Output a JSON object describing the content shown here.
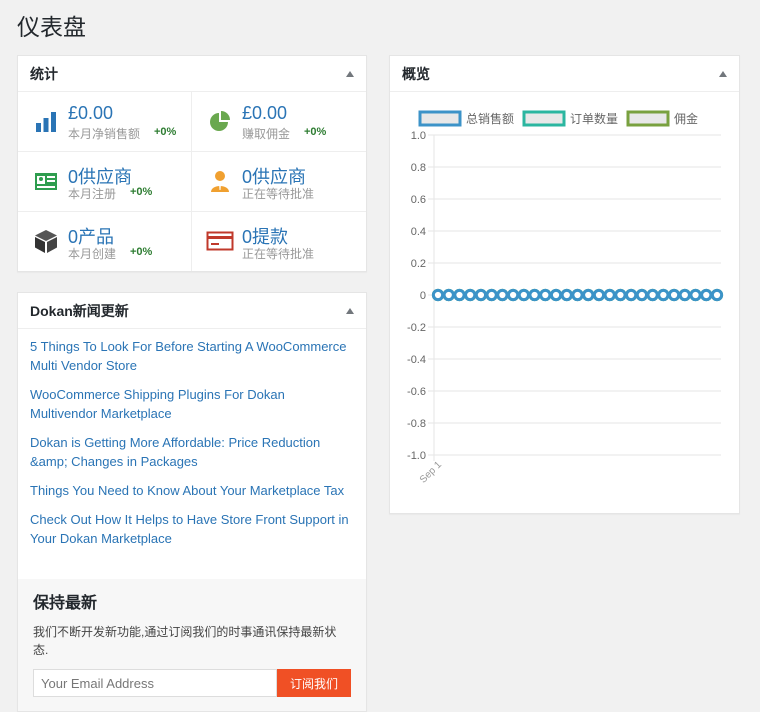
{
  "page": {
    "title": "仪表盘"
  },
  "stats_box": {
    "title": "统计",
    "items": [
      {
        "icon": "bar-chart-icon",
        "value": "£0.00",
        "label": "本月净销售额",
        "change": "+0%"
      },
      {
        "icon": "pie-chart-icon",
        "value": "£0.00",
        "label": "赚取佣金",
        "change": "+0%"
      },
      {
        "icon": "id-card-icon",
        "value": "0供应商",
        "label": "本月注册",
        "change": "+0%"
      },
      {
        "icon": "person-icon",
        "value": "0供应商",
        "label": "正在等待批准",
        "change": ""
      },
      {
        "icon": "box-icon",
        "value": "0产品",
        "label": "本月创建",
        "change": "+0%"
      },
      {
        "icon": "credit-card-icon",
        "value": "0提款",
        "label": "正在等待批准",
        "change": ""
      }
    ]
  },
  "news_box": {
    "title": "Dokan新闻更新",
    "items": [
      "5 Things To Look For Before Starting A WooCommerce Multi Vendor Store",
      "WooCommerce Shipping Plugins For Dokan Multivendor Marketplace",
      "Dokan is Getting More Affordable: Price Reduction &amp; Changes in Packages",
      "Things You Need to Know About Your Marketplace Tax",
      "Check Out How It Helps to Have Store Front Support in Your Dokan Marketplace"
    ],
    "subscribe": {
      "title": "保持最新",
      "text": "我们不断开发新功能,通过订阅我们的时事通讯保持最新状态.",
      "placeholder": "Your Email Address",
      "button": "订阅我们"
    }
  },
  "overview_box": {
    "title": "概览"
  },
  "colors": {
    "accent": "#2a74b5",
    "subscribe_button": "#f05025",
    "positive": "#2e7d32"
  },
  "chart_data": {
    "type": "line",
    "legend_position": "top",
    "series": [
      {
        "name": "总销售额",
        "color": "#3c93c8",
        "values": [
          0,
          0,
          0,
          0,
          0,
          0,
          0,
          0,
          0,
          0,
          0,
          0,
          0,
          0,
          0,
          0,
          0,
          0,
          0,
          0,
          0,
          0,
          0,
          0,
          0,
          0,
          0
        ]
      },
      {
        "name": "订单数量",
        "color": "#2bb6a0",
        "values": [
          0,
          0,
          0,
          0,
          0,
          0,
          0,
          0,
          0,
          0,
          0,
          0,
          0,
          0,
          0,
          0,
          0,
          0,
          0,
          0,
          0,
          0,
          0,
          0,
          0,
          0,
          0
        ]
      },
      {
        "name": "佣金",
        "color": "#79a13f",
        "values": [
          0,
          0,
          0,
          0,
          0,
          0,
          0,
          0,
          0,
          0,
          0,
          0,
          0,
          0,
          0,
          0,
          0,
          0,
          0,
          0,
          0,
          0,
          0,
          0,
          0,
          0,
          0
        ]
      }
    ],
    "x_tick_labels": [
      "Sep 1"
    ],
    "y_ticks": [
      "1.0",
      "0.8",
      "0.6",
      "0.4",
      "0.2",
      "0",
      "-0.2",
      "-0.4",
      "-0.6",
      "-0.8",
      "-1.0"
    ],
    "ylim": [
      -1.0,
      1.0
    ],
    "grid": true
  }
}
